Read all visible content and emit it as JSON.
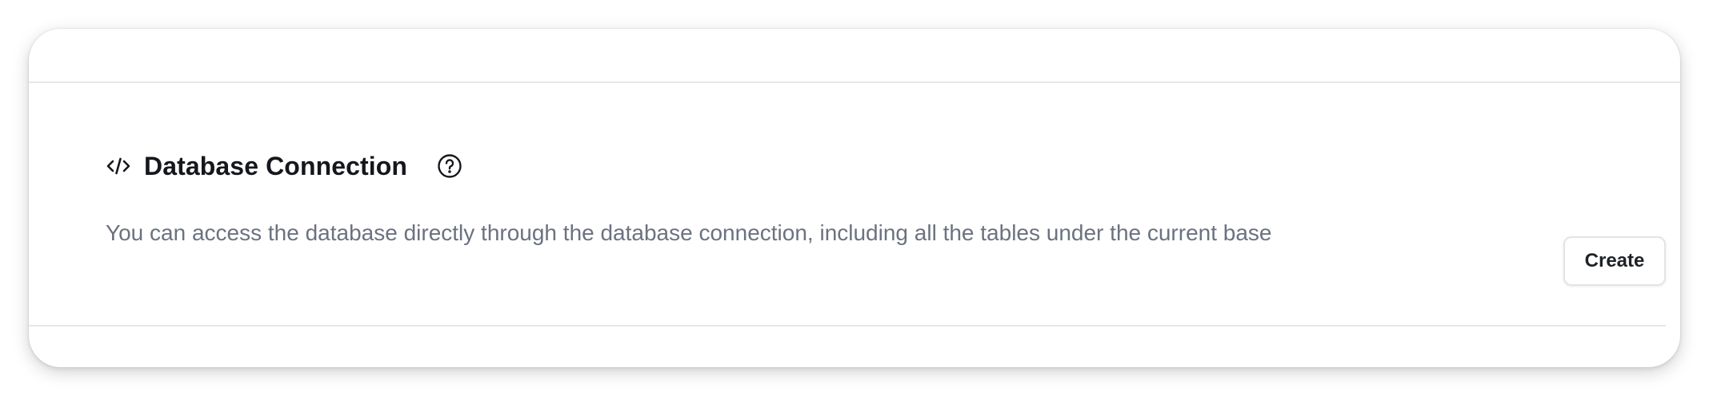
{
  "section": {
    "title": "Database Connection",
    "title_icon": "code-icon",
    "help_icon": "question-circle-icon",
    "description": "You can access the database directly through the database connection, including all the tables under the current base"
  },
  "actions": {
    "create_label": "Create"
  },
  "colors": {
    "title": "#15171c",
    "description": "#6b7280",
    "divider": "#e6e7ea",
    "button_border": "#e3e4e8"
  }
}
